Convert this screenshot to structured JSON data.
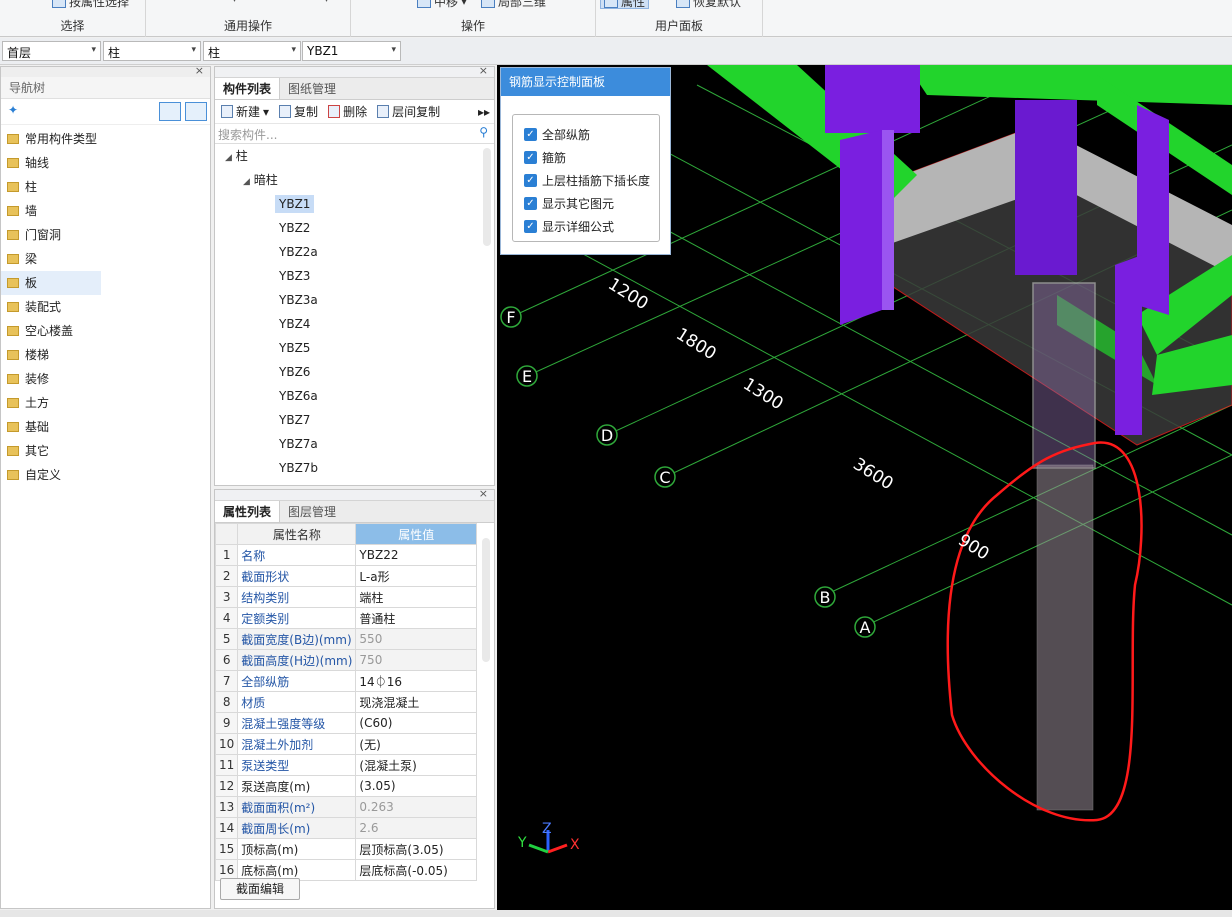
{
  "ribbon": {
    "groups": [
      {
        "label": "选择",
        "button": "按属性选择"
      },
      {
        "label": "通用操作"
      },
      {
        "label": "操作",
        "button": "中移",
        "button2": "局部三维"
      },
      {
        "label": "用户面板",
        "button": "属性",
        "button2": "恢复默认"
      }
    ]
  },
  "filters": {
    "floor": "首层",
    "type": "柱",
    "subtype": "柱",
    "component": "YBZ1"
  },
  "nav": {
    "title": "导航树",
    "items": [
      "常用构件类型",
      "轴线",
      "柱",
      "墙",
      "门窗洞",
      "梁",
      "板",
      "装配式",
      "空心楼盖",
      "楼梯",
      "装修",
      "土方",
      "基础",
      "其它",
      "自定义"
    ],
    "active_index": 6
  },
  "components": {
    "tabs": [
      "构件列表",
      "图纸管理"
    ],
    "toolbar": {
      "new": "新建",
      "copy": "复制",
      "delete": "删除",
      "floor_copy": "层间复制"
    },
    "search_placeholder": "搜索构件...",
    "tree_root": "柱",
    "tree_group": "暗柱",
    "items": [
      "YBZ1",
      "YBZ2",
      "YBZ2a",
      "YBZ3",
      "YBZ3a",
      "YBZ4",
      "YBZ5",
      "YBZ6",
      "YBZ6a",
      "YBZ7",
      "YBZ7a",
      "YBZ7b"
    ],
    "selected": "YBZ1"
  },
  "properties": {
    "tabs": [
      "属性列表",
      "图层管理"
    ],
    "col_name": "属性名称",
    "col_value": "属性值",
    "rows": [
      {
        "n": "1",
        "name": "名称",
        "value": "YBZ22",
        "blue": true,
        "grey": false
      },
      {
        "n": "2",
        "name": "截面形状",
        "value": "L-a形",
        "blue": true,
        "grey": false
      },
      {
        "n": "3",
        "name": "结构类别",
        "value": "端柱",
        "blue": true,
        "grey": false
      },
      {
        "n": "4",
        "name": "定额类别",
        "value": "普通柱",
        "blue": true,
        "grey": false
      },
      {
        "n": "5",
        "name": "截面宽度(B边)(mm)",
        "value": "550",
        "blue": true,
        "grey": true
      },
      {
        "n": "6",
        "name": "截面高度(H边)(mm)",
        "value": "750",
        "blue": true,
        "grey": true
      },
      {
        "n": "7",
        "name": "全部纵筋",
        "value": "14⏀16",
        "blue": true,
        "grey": false
      },
      {
        "n": "8",
        "name": "材质",
        "value": "现浇混凝土",
        "blue": true,
        "grey": false
      },
      {
        "n": "9",
        "name": "混凝土强度等级",
        "value": "(C60)",
        "blue": true,
        "grey": false
      },
      {
        "n": "10",
        "name": "混凝土外加剂",
        "value": "(无)",
        "blue": true,
        "grey": false
      },
      {
        "n": "11",
        "name": "泵送类型",
        "value": "(混凝土泵)",
        "blue": true,
        "grey": false
      },
      {
        "n": "12",
        "name": "泵送高度(m)",
        "value": "(3.05)",
        "blue": false,
        "grey": false
      },
      {
        "n": "13",
        "name": "截面面积(m²)",
        "value": "0.263",
        "blue": true,
        "grey": true
      },
      {
        "n": "14",
        "name": "截面周长(m)",
        "value": "2.6",
        "blue": true,
        "grey": true
      },
      {
        "n": "15",
        "name": "顶标高(m)",
        "value": "层顶标高(3.05)",
        "blue": false,
        "grey": false
      },
      {
        "n": "16",
        "name": "底标高(m)",
        "value": "层底标高(-0.05)",
        "blue": false,
        "grey": false
      }
    ],
    "edit_button": "截面编辑"
  },
  "rebar_panel": {
    "title": "钢筋显示控制面板",
    "options": [
      "全部纵筋",
      "箍筋",
      "上层柱插筋下插长度",
      "显示其它图元",
      "显示详细公式"
    ]
  },
  "viewport": {
    "axis_labels": [
      "F",
      "E",
      "D",
      "C",
      "B",
      "A"
    ],
    "dimensions": [
      "1200",
      "1800",
      "1300",
      "3600",
      "900"
    ],
    "axes": [
      "X",
      "Y",
      "Z"
    ],
    "colors": {
      "grid": "#2fa83a",
      "beam": "#22d42c",
      "column": "#7a1fe0",
      "slab": "#b5b5b5",
      "highlight": "#ff1a1a"
    }
  }
}
